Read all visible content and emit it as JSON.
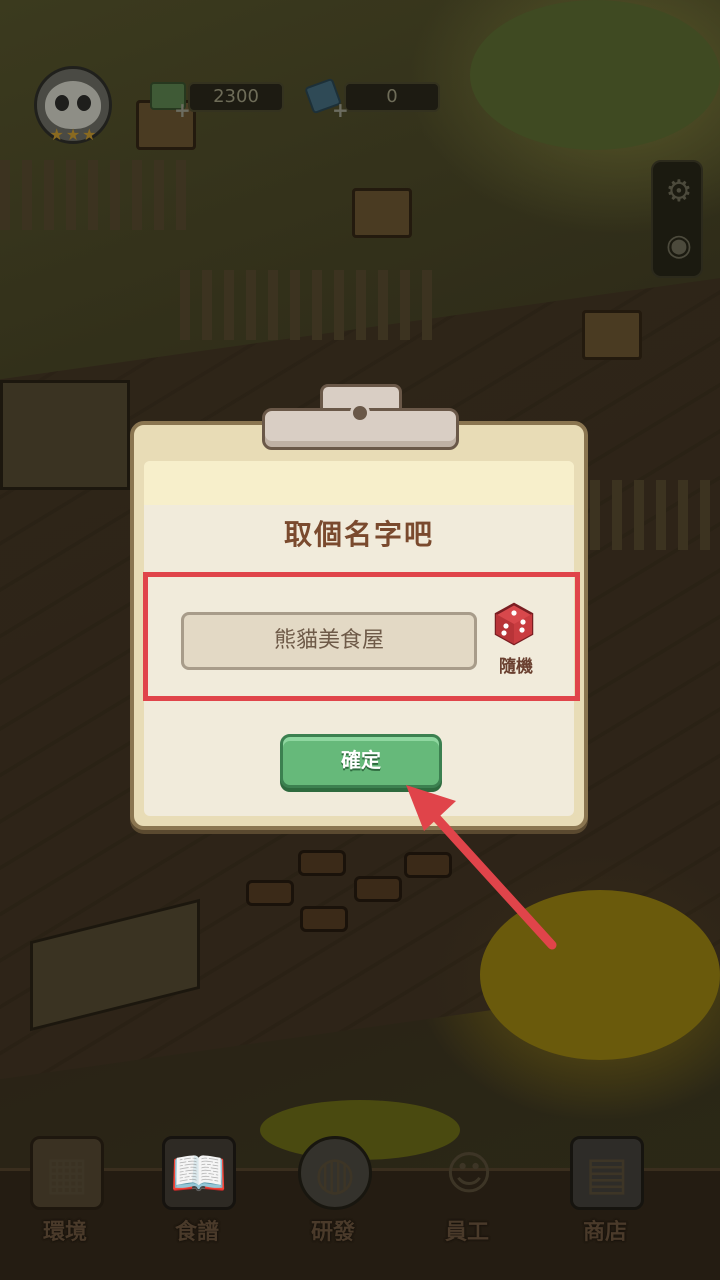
{
  "hud": {
    "cash_value": "2300",
    "gem_value": "0",
    "cash_icon": "cash-icon",
    "gem_icon": "gem-icon",
    "settings_icon": "gear-icon",
    "view_icon": "eye-icon",
    "avatar_icon": "panda-avatar-icon"
  },
  "dialog": {
    "title": "取個名字吧",
    "name_value": "熊貓美食屋",
    "random_label": "隨機",
    "random_icon": "dice-icon",
    "confirm_label": "確定"
  },
  "bottom_nav": {
    "items": [
      {
        "label": "環境",
        "icon": "environment-icon"
      },
      {
        "label": "食譜",
        "icon": "recipe-book-icon"
      },
      {
        "label": "研發",
        "icon": "cooking-pot-icon"
      },
      {
        "label": "員工",
        "icon": "staff-icon"
      },
      {
        "label": "商店",
        "icon": "shop-icon"
      }
    ]
  },
  "colors": {
    "highlight": "#e0444a",
    "confirm_button": "#66b97a",
    "dialog_title": "#7a4a2e"
  }
}
